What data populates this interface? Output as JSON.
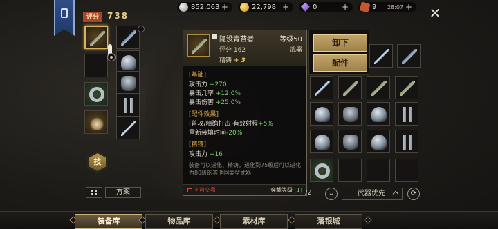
{
  "header": {
    "score_label": "评分",
    "score_value": "738"
  },
  "currencies": [
    {
      "icon": "silver-coin-icon",
      "value": "852,063"
    },
    {
      "icon": "gold-coin-icon",
      "value": "22,798"
    },
    {
      "icon": "purple-gem-icon",
      "value": "0"
    },
    {
      "icon": "stamina-ticket-icon",
      "value": "9",
      "timer": "28:07"
    }
  ],
  "tooltip": {
    "name": "隐没青苔者",
    "level": "等级50",
    "score": "评分 162",
    "type": "武器",
    "refine_label": "精铸",
    "refine_value": "+ 3",
    "basic_header": "[基础]",
    "stats": [
      {
        "label": "攻击力",
        "value": "+270"
      },
      {
        "label": "暴击几率",
        "value": "+12.0%"
      },
      {
        "label": "暴击伤害",
        "value": "+25.0%"
      }
    ],
    "parts_header": "[配件效果]",
    "parts": [
      {
        "label": "(普攻/精确打击)有效射程",
        "value": "+5%"
      },
      {
        "label": "重新装填时间",
        "value": "-20%"
      }
    ],
    "refine_header": "[精铸]",
    "refine_stat": {
      "label": "攻击力",
      "value": "+16"
    },
    "note": "装备可以进化、精铸，进化到75级后可以进化为80级的其他同类型武器",
    "untradeable": "不可交易",
    "wear_level": "穿戴等级",
    "wear_value": "[1]"
  },
  "actions": {
    "unequip": "卸下",
    "parts": "配件"
  },
  "skill_label": "技",
  "plan_label": "方案",
  "bag": {
    "page": "/2",
    "priority": "武器优先"
  },
  "tabs": [
    "装备库",
    "物品库",
    "素材库",
    "落银城"
  ],
  "active_tab": 0,
  "colors": {
    "accent_gold": "#d8b25c",
    "stat_green": "#7bd26c",
    "lock_red": "#d24a3a",
    "score_badge": "#a8462a"
  }
}
